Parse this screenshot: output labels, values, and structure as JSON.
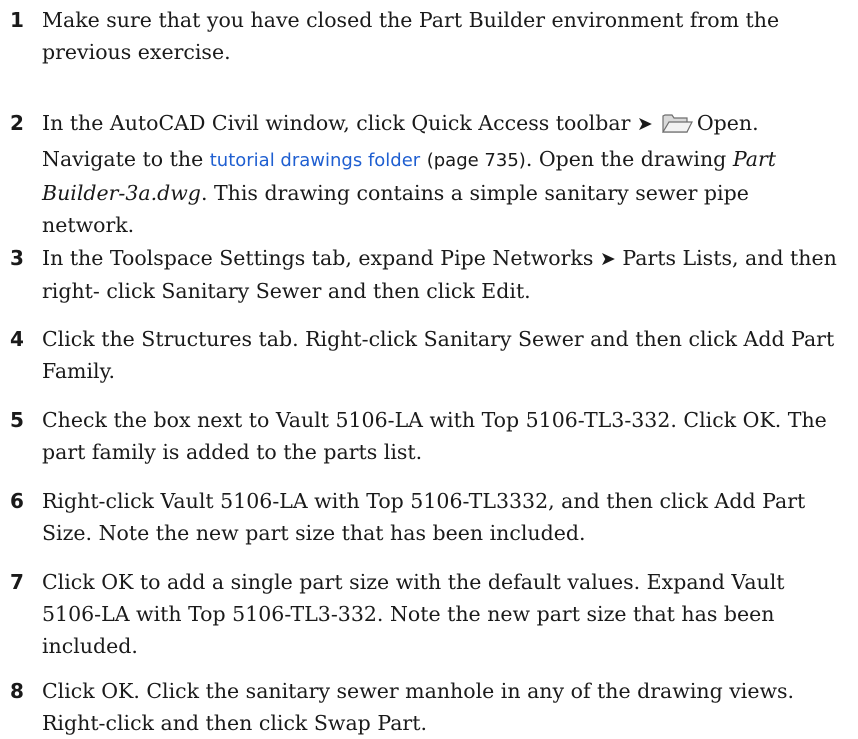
{
  "steps": [
    {
      "num": "1",
      "text": "Make sure that you have closed the Part Builder environment from the previous exercise."
    },
    {
      "num": "2",
      "a": "In the AutoCAD Civil window, click Quick Access toolbar",
      "arrow": "➤",
      "icon": "open-folder-icon",
      "b": "Open.",
      "c": "Navigate to the",
      "link": "tutorial drawings folder",
      "pageref": "(page 735)",
      "d": ". Open the drawing",
      "file": "Part Builder-3a.dwg",
      "e": ". This drawing contains a simple sanitary sewer pipe network."
    },
    {
      "num": "3",
      "a": "In the Toolspace Settings tab, expand Pipe Networks",
      "arrow": "➤",
      "b": "Parts Lists, and then right- click Sanitary Sewer and then click Edit."
    },
    {
      "num": "4",
      "text": "Click the Structures tab. Right-click Sanitary Sewer and then click Add Part Family."
    },
    {
      "num": "5",
      "text": "Check the box next to Vault 5106-LA with Top 5106-TL3-332. Click OK. The part family is added to the parts list."
    },
    {
      "num": "6",
      "text": "Right-click Vault 5106-LA with Top 5106-TL3332, and then click Add Part Size. Note the new part size that has been included."
    },
    {
      "num": "7",
      "text": "Click OK to add a single part size with the default values. Expand Vault 5106-LA with Top 5106-TL3-332. Note the new part size that has been included."
    },
    {
      "num": "8",
      "text": "Click OK. Click the sanitary sewer manhole in any of the drawing views. Right-click and then click Swap Part."
    }
  ]
}
